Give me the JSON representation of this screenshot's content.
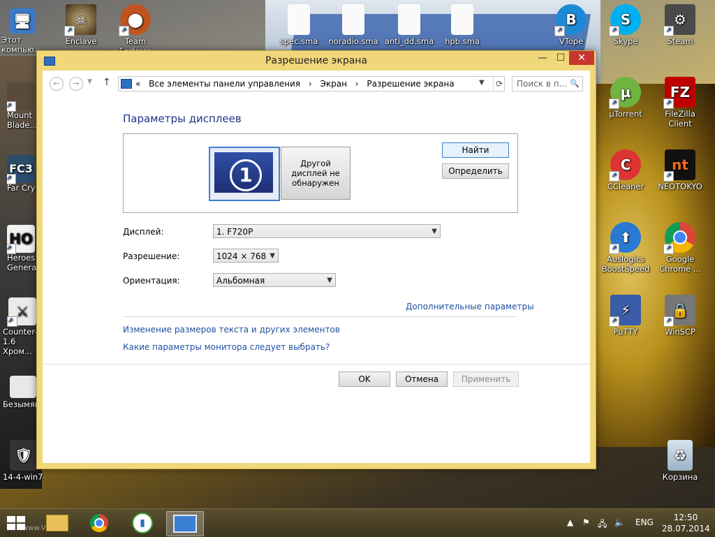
{
  "window": {
    "title": "Разрешение экрана",
    "controls": {
      "minimize": "—",
      "maximize": "☐",
      "close": "✕"
    }
  },
  "address": {
    "overflow": "«",
    "crumbs": [
      "Все элементы панели управления",
      "›",
      "Экран",
      "›",
      "Разрешение экрана"
    ],
    "search_placeholder": "Поиск в п..."
  },
  "content": {
    "heading": "Параметры дисплеев",
    "monitor1_number": "1",
    "monitor2_text": "Другой дисплей не обнаружен",
    "find_button": "Найти",
    "detect_button": "Определить",
    "display_label": "Дисплей:",
    "display_value": "1. F720P",
    "resolution_label": "Разрешение:",
    "resolution_value": "1024 × 768",
    "orientation_label": "Ориентация:",
    "orientation_value": "Альбомная",
    "advanced_link": "Дополнительные параметры",
    "text_size_link": "Изменение размеров текста и других элементов",
    "which_settings_link": "Какие параметры монитора следует выбрать?",
    "ok_button": "OK",
    "cancel_button": "Отмена",
    "apply_button": "Применить"
  },
  "desktop_icons": {
    "left": [
      "Этот компью...",
      "Mount Blade...",
      "Far Cry",
      "Heroes Genera...",
      "Counter-... 1.6 Хром...",
      "Безымян...",
      "14-4-win7-..."
    ],
    "top": [
      "Enclave",
      "Team Fortress",
      "spec.sma",
      "noradio.sma",
      "anti_dd.sma",
      "hpb.sma"
    ],
    "right": [
      "VTope",
      "Skype",
      "Steam",
      "µTorrent",
      "FileZilla Client",
      "CCleaner",
      "NEOTOKYO",
      "Auslogics BoostSpeed",
      "Google Chrome ...",
      "PuTTY",
      "WinSCP",
      "Корзина"
    ]
  },
  "taskbar": {
    "watermark": "www.VE...l.ru",
    "language": "ENG",
    "time": "12:50",
    "date": "28.07.2014"
  },
  "colors": {
    "window_frame": "#f0d77a",
    "close_button": "#c7372d",
    "link": "#1e50a0",
    "heading": "#1e3287"
  }
}
